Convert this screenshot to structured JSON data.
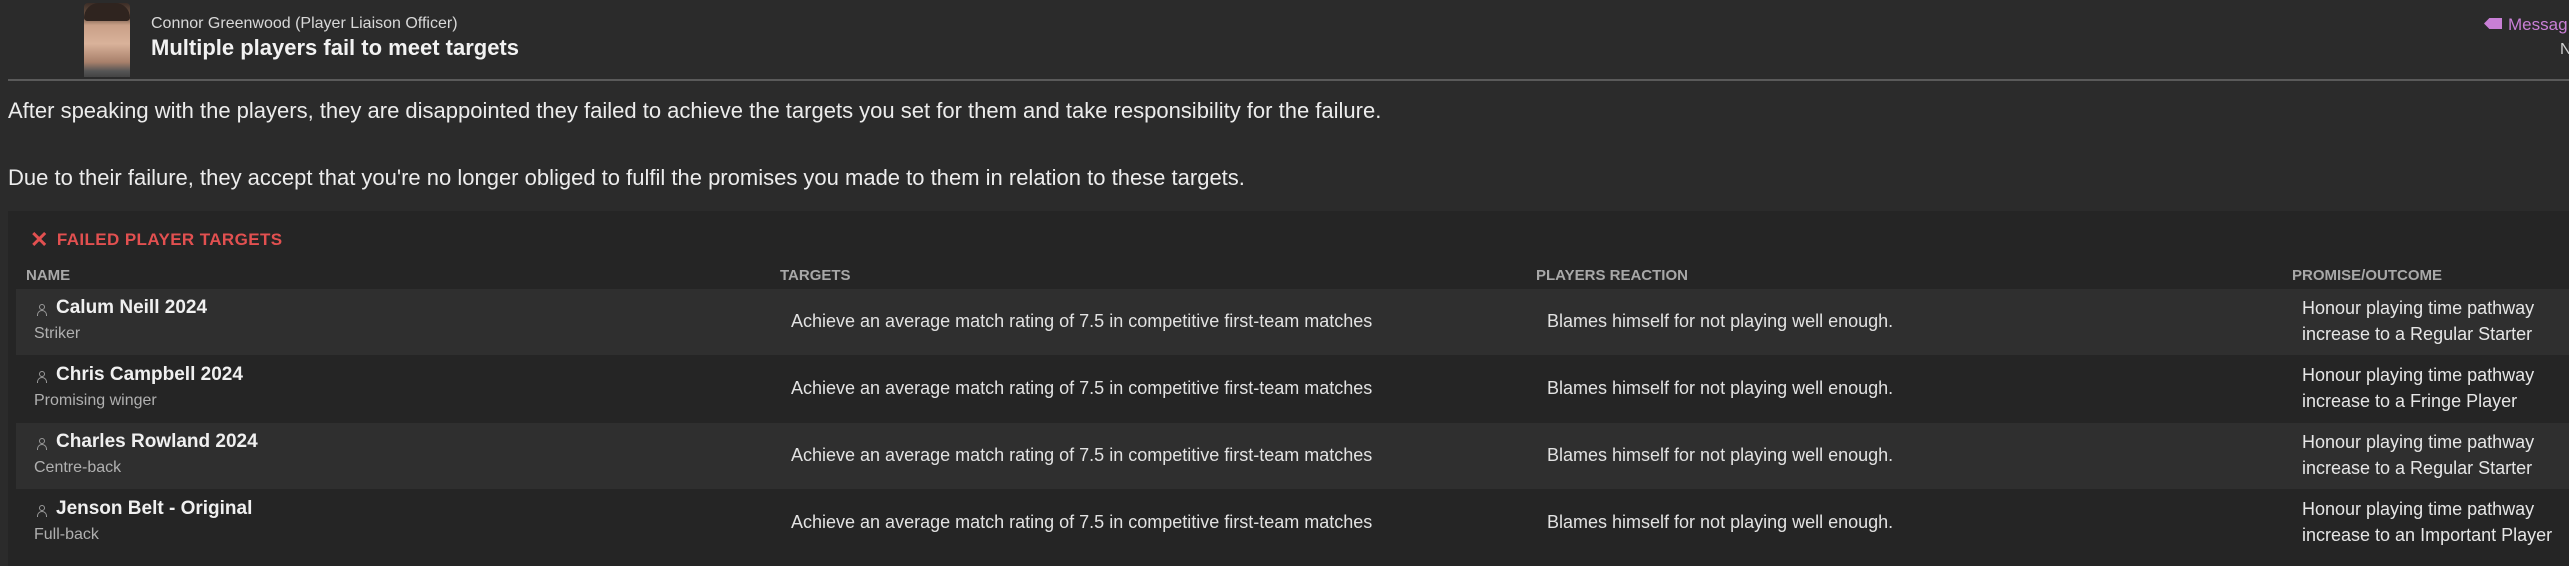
{
  "header": {
    "sender": "Connor Greenwood (Player Liaison Officer)",
    "subject": "Multiple players fail to meet targets",
    "message_button": "Messag",
    "message_sub": "N"
  },
  "body": {
    "paragraph1": "After speaking with the players, they are disappointed they failed to achieve the targets you set for them and take responsibility for the failure.",
    "paragraph2": "Due to their failure, they accept that you're no longer obliged to fulfil the promises you made to them in relation to these targets."
  },
  "panel": {
    "title": "FAILED PLAYER TARGETS",
    "title_color": "#e25050",
    "columns": {
      "name": "NAME",
      "targets": "TARGETS",
      "reaction": "PLAYERS REACTION",
      "promise": "PROMISE/OUTCOME"
    },
    "rows": [
      {
        "name": "Calum Neill 2024",
        "position": "Striker",
        "target": "Achieve an average match rating of 7.5 in competitive first-team matches",
        "reaction": "Blames himself for not playing well enough.",
        "promise_line1": "Honour playing time pathway",
        "promise_line2": "increase to a Regular Starter"
      },
      {
        "name": "Chris Campbell 2024",
        "position": "Promising winger",
        "target": "Achieve an average match rating of 7.5 in competitive first-team matches",
        "reaction": "Blames himself for not playing well enough.",
        "promise_line1": "Honour playing time pathway",
        "promise_line2": "increase to a Fringe Player"
      },
      {
        "name": "Charles Rowland 2024",
        "position": "Centre-back",
        "target": "Achieve an average match rating of 7.5 in competitive first-team matches",
        "reaction": "Blames himself for not playing well enough.",
        "promise_line1": "Honour playing time pathway",
        "promise_line2": "increase to a Regular Starter"
      },
      {
        "name": "Jenson Belt - Original",
        "position": "Full-back",
        "target": "Achieve an average match rating of 7.5 in competitive first-team matches",
        "reaction": "Blames himself for not playing well enough.",
        "promise_line1": "Honour playing time pathway",
        "promise_line2": "increase to an Important Player"
      }
    ]
  }
}
